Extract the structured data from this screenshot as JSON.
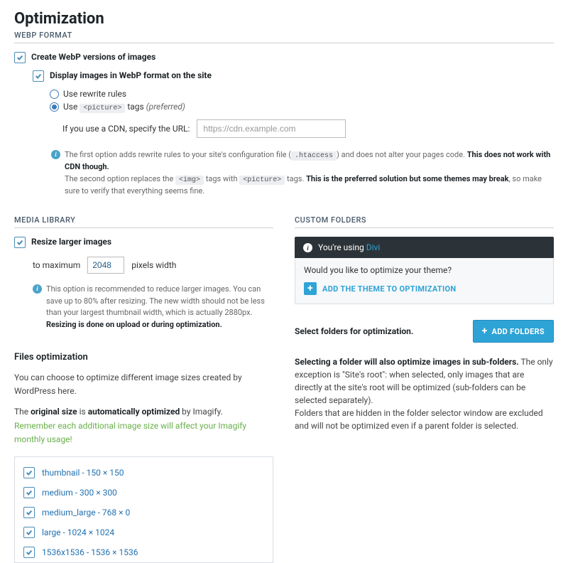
{
  "heading": "Optimization",
  "sections": {
    "webp": {
      "label": "WEBP FORMAT",
      "createLabel": "Create WebP versions of images",
      "displayLabel": "Display images in WebP format on the site",
      "opt1": "Use rewrite rules",
      "opt2a": "Use ",
      "opt2code": "<picture>",
      "opt2b": " tags ",
      "opt2pref": "(preferred)",
      "cdnLabel": "If you use a CDN, specify the URL:",
      "cdnPlaceholder": "https://cdn.example.com",
      "note1a": "The first option adds rewrite rules to your site's configuration file (",
      "note1code": ".htaccess",
      "note1b": ") and does not alter your pages code. ",
      "note1bold": "This does not work with CDN though.",
      "note2a": "The second option replaces the ",
      "note2code1": "<img>",
      "note2b": " tags with ",
      "note2code2": "<picture>",
      "note2c": " tags. ",
      "note2bold": "This is the preferred solution but some themes may break",
      "note2d": ", so make sure to verify that everything seems fine."
    },
    "media": {
      "label": "MEDIA LIBRARY",
      "resizeLabel": "Resize larger images",
      "toMax": "to maximum",
      "value": "2048",
      "pxWidth": "pixels width",
      "help": "This option is recommended to reduce larger images. You can save up to 80% after resizing. The new width should not be less than your largest thumbnail width, which is actually 2880px. ",
      "helpBold": "Resizing is done on upload or during optimization."
    },
    "custom": {
      "label": "CUSTOM FOLDERS",
      "using": "You're using ",
      "theme": "Divi",
      "question": "Would you like to optimize your theme?",
      "addTheme": "ADD THE THEME TO OPTIMIZATION",
      "selectLabel": "Select folders for optimization.",
      "addFolders": "ADD FOLDERS",
      "help1bold": "Selecting a folder will also optimize images in sub-folders.",
      "help1": " The only exception is \"Site's root\": when selected, only images that are directly at the site's root will be optimized (sub-folders can be selected separately).",
      "help2": "Folders that are hidden in the folder selector window are excluded and will not be optimized even if a parent folder is selected."
    },
    "files": {
      "heading": "Files optimization",
      "p1": "You can choose to optimize different image sizes created by WordPress here.",
      "p2a": "The ",
      "p2b": "original size",
      "p2c": " is ",
      "p2d": "automatically optimized",
      "p2e": " by Imagify.",
      "p3": "Remember each additional image size will affect your Imagify monthly usage!",
      "sizes": [
        "thumbnail - 150 × 150",
        "medium - 300 × 300",
        "medium_large - 768 × 0",
        "large - 1024 × 1024",
        "1536x1536 - 1536 × 1536"
      ]
    }
  }
}
